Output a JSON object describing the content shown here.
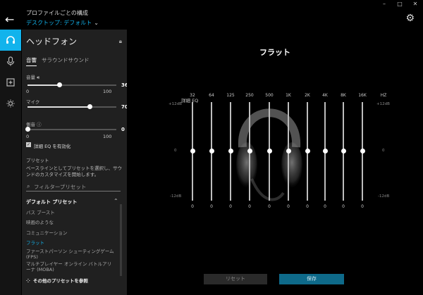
{
  "window": {
    "controls": [
      "–",
      "□",
      "✕"
    ]
  },
  "header": {
    "profile_heading": "プロファイルごとの構成",
    "profile_value": "デスクトップ: デフォルト"
  },
  "rail": {
    "items": [
      "headphones",
      "microphone",
      "add",
      "lighting"
    ]
  },
  "panel": {
    "title": "ヘッドフォン",
    "tabs": [
      "音響",
      "サラウンドサウンド"
    ],
    "volume": {
      "label": "音量",
      "value": 36,
      "min": "0",
      "max": "100",
      "value_text": "36"
    },
    "mic": {
      "label": "マイク",
      "value": 70,
      "min": "0",
      "max": "100",
      "value_text": "70"
    },
    "sidetone": {
      "label": "側音",
      "value": 0,
      "min": "0",
      "max": "100",
      "value_text": "0"
    },
    "advanced_eq": {
      "label": "詳細 EQ を有効化",
      "checked": true,
      "mark": "✓"
    },
    "preset_heading": "プリセット",
    "preset_desc": "ベースラインとしてプリセットを選択し、サウンドのカスタマイズを開始します。",
    "filter_placeholder": "フィルタープリセット",
    "default_presets_heading": "デフォルト プリセット",
    "presets": [
      "バス ブースト",
      "映画のような",
      "コミュニケーション",
      "フラット",
      "ファーストパーソン シューティングゲーム (FPS)",
      "マルチプレイヤー オンライン バトルアリーナ (MOBA)"
    ],
    "selected_preset": "フラット",
    "more_presets": "その他のプリセットを参照"
  },
  "main": {
    "title": "フラット",
    "eq_label": "詳細 EQ",
    "hz_label": "HZ",
    "db_top": "+12dB",
    "db_mid": "0",
    "db_bottom": "-12dB",
    "bands": [
      "32",
      "64",
      "125",
      "250",
      "500",
      "1K",
      "2K",
      "4K",
      "8K",
      "16K"
    ],
    "band_values": [
      "0",
      "0",
      "0",
      "0",
      "0",
      "0",
      "0",
      "0",
      "0",
      "0"
    ],
    "reset_label": "リセット",
    "save_label": "保存"
  },
  "colors": {
    "accent": "#12b3ec",
    "panel_bg": "#202020",
    "rail_bg": "#141414",
    "save_bg": "#0e6a8a"
  }
}
